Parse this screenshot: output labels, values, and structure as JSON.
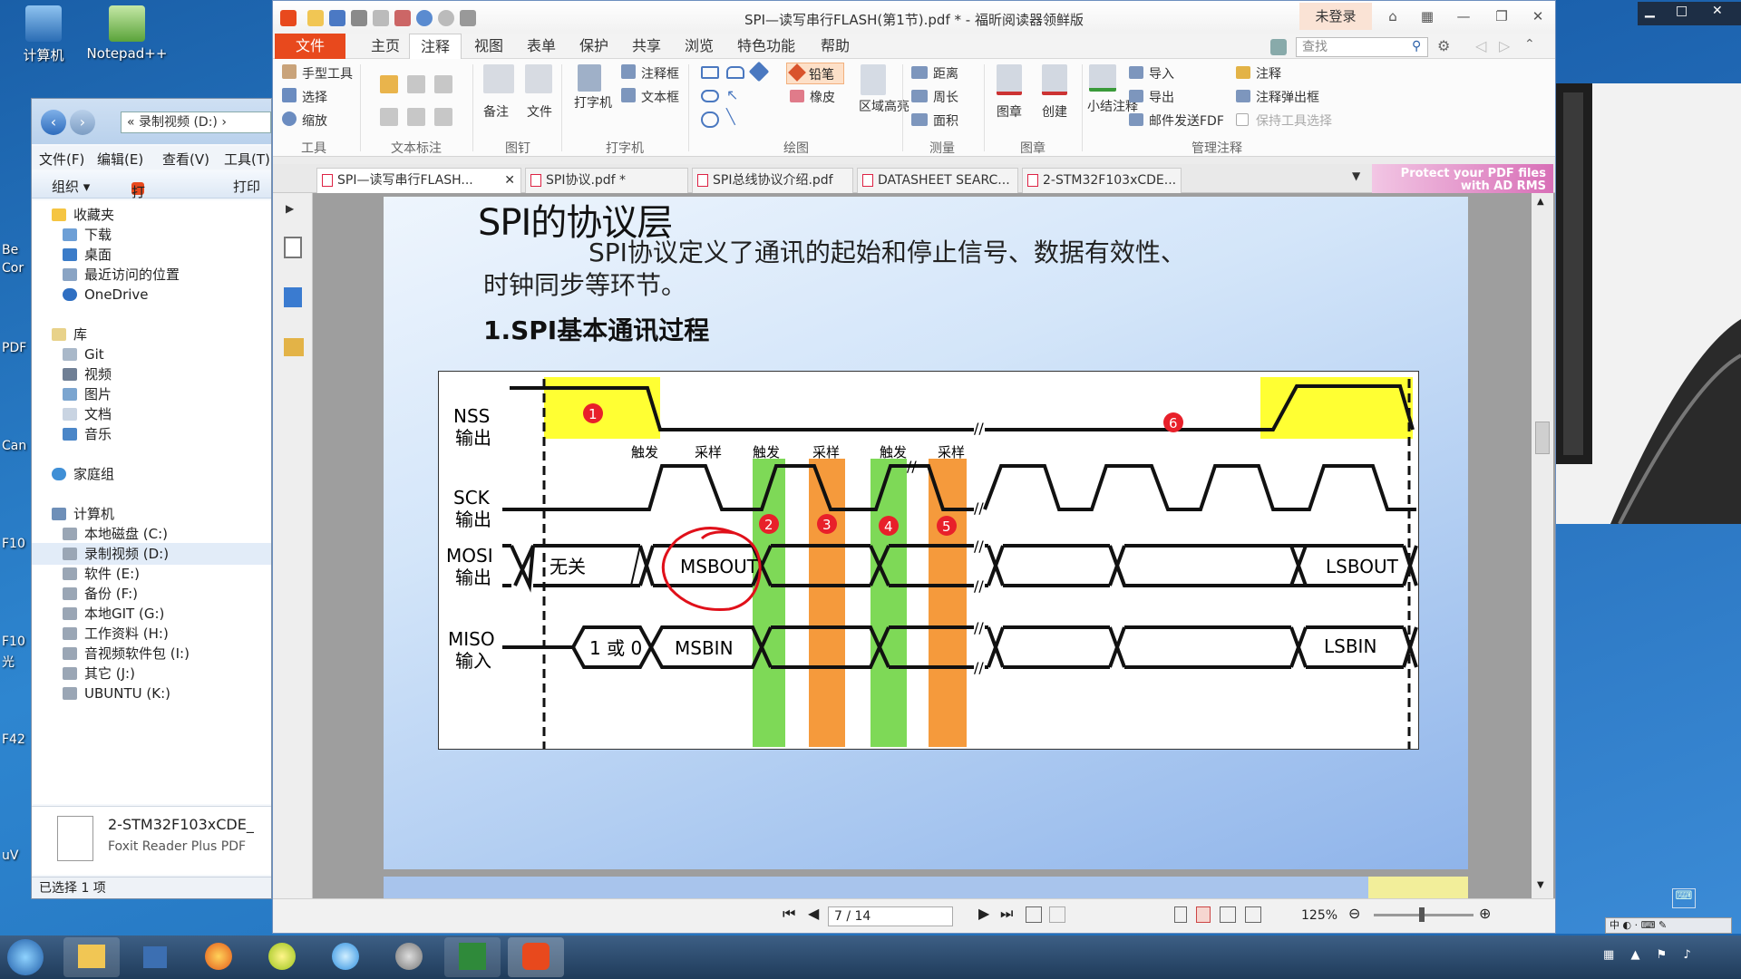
{
  "desktop": {
    "icons": [
      {
        "label": "计算机"
      },
      {
        "label": "Notepad++"
      }
    ],
    "left_labels": [
      "Be",
      "Cor",
      "PDF",
      "Can",
      "F10",
      "F10",
      "光",
      "F42",
      "uV"
    ]
  },
  "explorer": {
    "address": "« 录制视频 (D:) ›",
    "menu": [
      "文件(F)",
      "编辑(E)",
      "查看(V)",
      "工具(T)"
    ],
    "toolbar": [
      "组织 ▾",
      "打开 ▾",
      "打印"
    ],
    "tree": [
      {
        "label": "收藏夹",
        "group": true
      },
      {
        "label": "下载"
      },
      {
        "label": "桌面"
      },
      {
        "label": "最近访问的位置"
      },
      {
        "label": "OneDrive"
      },
      {
        "label": "库",
        "group": true
      },
      {
        "label": "Git"
      },
      {
        "label": "视频"
      },
      {
        "label": "图片"
      },
      {
        "label": "文档"
      },
      {
        "label": "音乐"
      },
      {
        "label": "家庭组",
        "group": true
      },
      {
        "label": "计算机",
        "group": true
      },
      {
        "label": "本地磁盘 (C:)"
      },
      {
        "label": "录制视频 (D:)",
        "selected": true
      },
      {
        "label": "软件 (E:)"
      },
      {
        "label": "备份 (F:)"
      },
      {
        "label": "本地GIT (G:)"
      },
      {
        "label": "工作资料 (H:)"
      },
      {
        "label": "音视频软件包 (I:)"
      },
      {
        "label": "其它 (J:)"
      },
      {
        "label": "UBUNTU (K:)"
      }
    ],
    "detail": {
      "name": "2-STM32F103xCDE_",
      "type": "Foxit Reader Plus PDF"
    },
    "status": "已选择 1 项"
  },
  "foxit": {
    "title": "SPI—读写串行FLASH(第1节).pdf * - 福昕阅读器领鲜版",
    "login": "未登录",
    "tabs": [
      "文件",
      "主页",
      "注释",
      "视图",
      "表单",
      "保护",
      "共享",
      "浏览",
      "特色功能",
      "帮助"
    ],
    "active_tab": "注释",
    "search_placeholder": "查找",
    "ribbon": {
      "tools": {
        "items": [
          "手型工具",
          "选择",
          "缩放"
        ],
        "group": "工具"
      },
      "text_markup": {
        "group": "文本标注"
      },
      "pin": {
        "items": [
          "备注",
          "文件"
        ],
        "group": "图钉"
      },
      "typewriter": {
        "items": [
          "打字机",
          "注释框",
          "文本框"
        ],
        "group": "打字机"
      },
      "drawing": {
        "items": [
          "铅笔",
          "橡皮",
          "区域高亮"
        ],
        "group": "绘图"
      },
      "measure": {
        "items": [
          "距离",
          "周长",
          "面积"
        ],
        "group": "测量"
      },
      "stamp": {
        "items": [
          "图章",
          "创建"
        ],
        "group": "图章"
      },
      "manage": {
        "items": [
          "小结注释",
          "导入",
          "导出",
          "邮件发送FDF",
          "注释",
          "注释弹出框",
          "保持工具选择"
        ],
        "group": "管理注释"
      }
    },
    "doc_tabs": [
      "SPI—读写串行FLASH...",
      "SPI协议.pdf *",
      "SPI总线协议介绍.pdf",
      "DATASHEET SEARC...",
      "2-STM32F103xCDE..."
    ],
    "protect_banner": "Protect your PDF files with AD RMS",
    "page_indicator": "7 / 14",
    "zoom": "125%"
  },
  "slide": {
    "title": "SPI的协议层",
    "body": "SPI协议定义了通讯的起始和停止信号、数据有效性、时钟同步等环节。",
    "heading": "1.SPI基本通讯过程"
  },
  "diagram": {
    "signals": [
      {
        "name": "NSS",
        "dir": "输出"
      },
      {
        "name": "SCK",
        "dir": "输出"
      },
      {
        "name": "MOSI",
        "dir": "输出"
      },
      {
        "name": "MISO",
        "dir": "输入"
      }
    ],
    "edge_labels": [
      "触发",
      "采样",
      "触发",
      "采样",
      "触发",
      "采样"
    ],
    "markers": [
      "1",
      "2",
      "3",
      "4",
      "5",
      "6"
    ],
    "mosi": {
      "dontcare": "无关",
      "first": "MSBOUT",
      "last": "LSBOUT"
    },
    "miso": {
      "first_value": "1 或 0",
      "first": "MSBIN",
      "last": "LSBIN"
    },
    "colors": {
      "highlight": "#ffff33",
      "trigger": "#7ed957",
      "sample": "#f59a3c",
      "marker": "#e8202a",
      "annotation": "#e0101a"
    }
  }
}
